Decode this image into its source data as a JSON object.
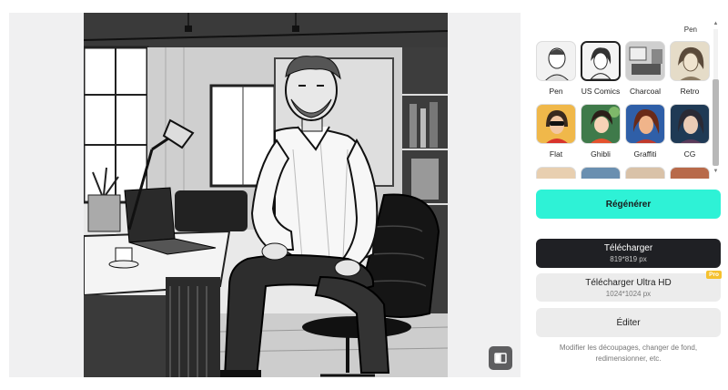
{
  "styles": {
    "partial_top_label": "Pen",
    "items": [
      {
        "label": "Pen",
        "selected": false
      },
      {
        "label": "US Comics",
        "selected": true
      },
      {
        "label": "Charcoal",
        "selected": false
      },
      {
        "label": "Retro",
        "selected": false
      },
      {
        "label": "Flat",
        "selected": false
      },
      {
        "label": "Ghibli",
        "selected": false
      },
      {
        "label": "Graffiti",
        "selected": false
      },
      {
        "label": "CG",
        "selected": false
      }
    ]
  },
  "actions": {
    "regenerate_label": "Régénérer",
    "download_label": "Télécharger",
    "download_size": "819*819 px",
    "download_hd_label": "Télécharger Ultra HD",
    "download_hd_size": "1024*1024 px",
    "pro_badge": "Pro",
    "edit_label": "Éditer",
    "hint": "Modifier les découpages, changer de fond, redimensionner, etc."
  },
  "colors": {
    "accent": "#2ef2d6",
    "dark_button": "#1f2024",
    "pro_badge": "#f5c12e"
  },
  "icons": {
    "close": "close-icon",
    "compare": "compare-icon"
  }
}
